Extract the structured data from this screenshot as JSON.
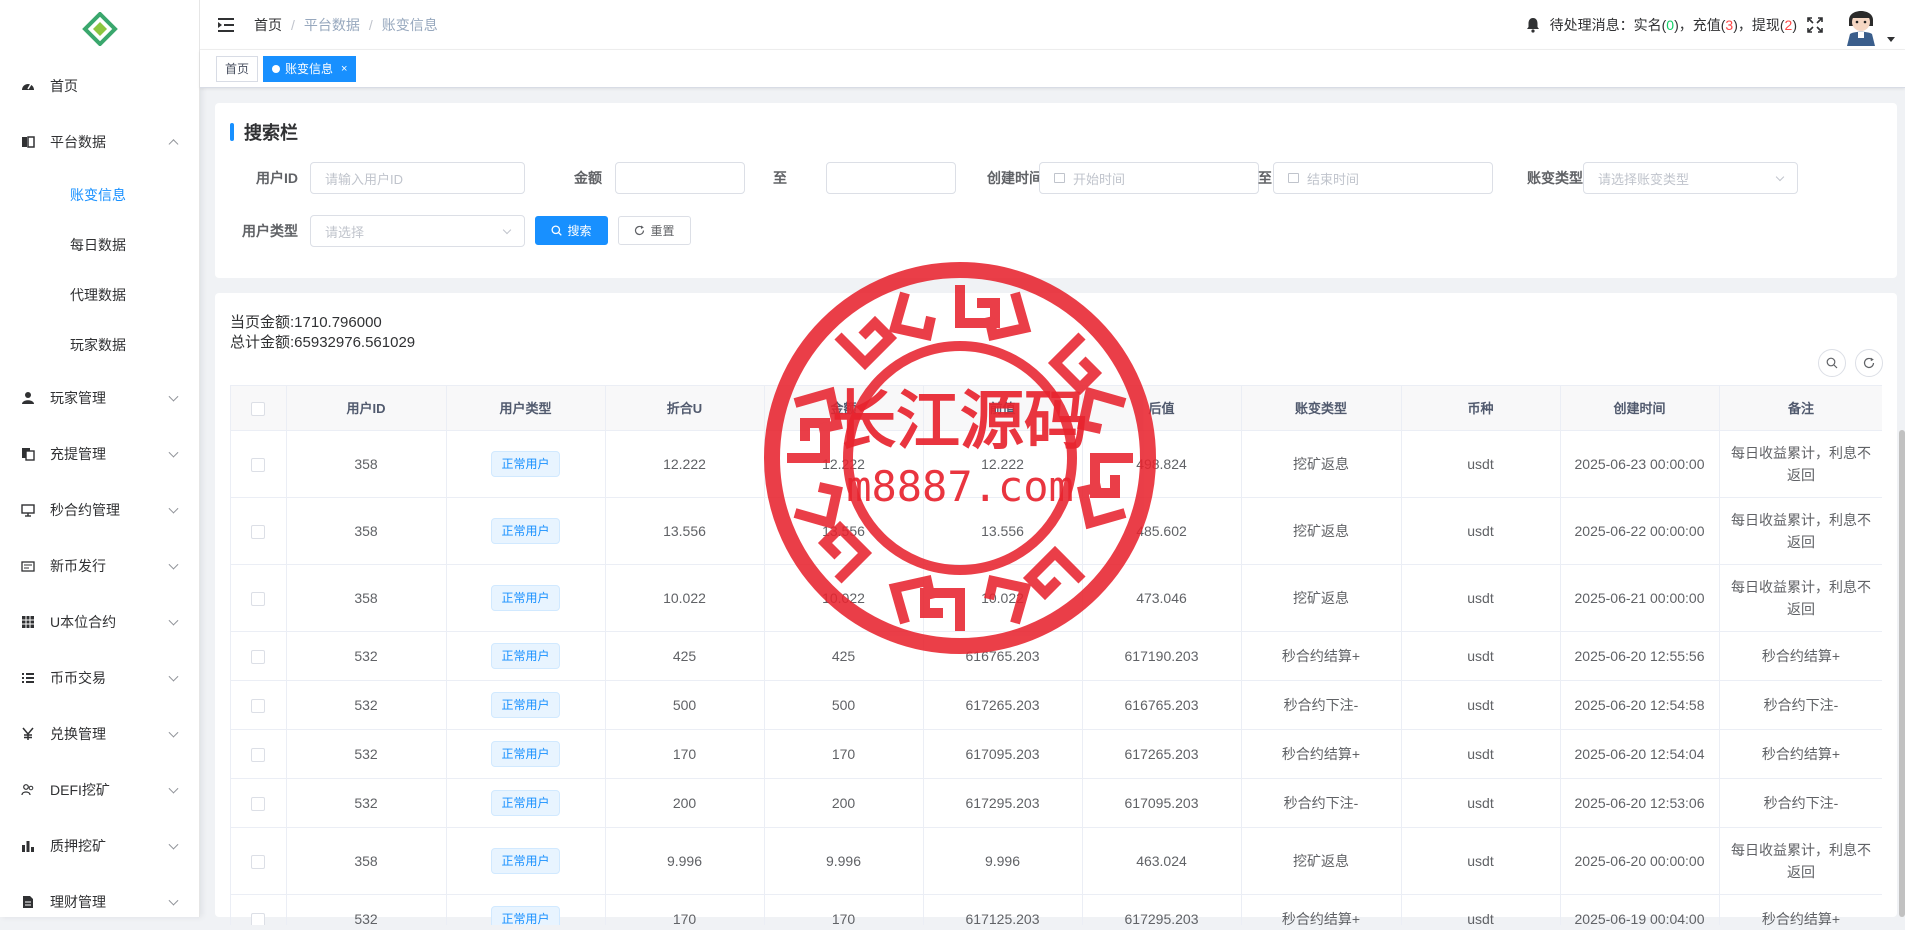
{
  "sidebar": {
    "items": [
      {
        "label": "首页",
        "icon": "dashboard-icon",
        "has_children": false
      },
      {
        "label": "平台数据",
        "icon": "book-icon",
        "has_children": true,
        "expanded": true,
        "children": [
          {
            "label": "账变信息",
            "active": true
          },
          {
            "label": "每日数据",
            "active": false
          },
          {
            "label": "代理数据",
            "active": false
          },
          {
            "label": "玩家数据",
            "active": false
          }
        ]
      },
      {
        "label": "玩家管理",
        "icon": "user-icon",
        "has_children": true
      },
      {
        "label": "充提管理",
        "icon": "copy-icon",
        "has_children": true
      },
      {
        "label": "秒合约管理",
        "icon": "monitor-icon",
        "has_children": true
      },
      {
        "label": "新币发行",
        "icon": "card-icon",
        "has_children": true
      },
      {
        "label": "U本位合约",
        "icon": "grid-icon",
        "has_children": true
      },
      {
        "label": "币币交易",
        "icon": "list-icon",
        "has_children": true
      },
      {
        "label": "兑换管理",
        "icon": "yen-icon",
        "has_children": true
      },
      {
        "label": "DEFI挖矿",
        "icon": "people-icon",
        "has_children": true
      },
      {
        "label": "质押挖矿",
        "icon": "bar-chart-icon",
        "has_children": true
      },
      {
        "label": "理财管理",
        "icon": "document-icon",
        "has_children": true
      }
    ]
  },
  "header": {
    "breadcrumb": [
      "首页",
      "平台数据",
      "账变信息"
    ],
    "pending_prefix": "待处理消息：实名(",
    "pending_realname": "0",
    "pending_mid1": ")，充值(",
    "pending_recharge": "3",
    "pending_mid2": ")，提现(",
    "pending_withdraw": "2",
    "pending_suffix": ")"
  },
  "tags": [
    {
      "label": "首页",
      "active": false
    },
    {
      "label": "账变信息",
      "active": true,
      "close": "×"
    }
  ],
  "search": {
    "title": "搜索栏",
    "user_id_label": "用户ID",
    "user_id_placeholder": "请输入用户ID",
    "amount_label": "金额",
    "to_label": "至",
    "created_label": "创建时间",
    "start_placeholder": "开始时间",
    "end_placeholder": "结束时间",
    "change_type_label": "账变类型",
    "change_type_placeholder": "请选择账变类型",
    "user_type_label": "用户类型",
    "user_type_placeholder": "请选择",
    "search_button": "搜索",
    "reset_button": "重置"
  },
  "summary": {
    "page_amount": "当页金额:1710.796000",
    "total_amount": "总计金额:65932976.561029"
  },
  "table": {
    "columns": [
      "用户ID",
      "用户类型",
      "折合U",
      "金额",
      "前值",
      "后值",
      "账变类型",
      "币种",
      "创建时间",
      "备注"
    ],
    "rows": [
      {
        "uid": "358",
        "type": "正常用户",
        "u": "12.222",
        "amount": "12.222",
        "before": "12.222",
        "after": "498.824",
        "change": "挖矿返息",
        "coin": "usdt",
        "time": "2025-06-23 00:00:00",
        "note": "每日收益累计，利息不返回"
      },
      {
        "uid": "358",
        "type": "正常用户",
        "u": "13.556",
        "amount": "13.556",
        "before": "13.556",
        "after": "485.602",
        "change": "挖矿返息",
        "coin": "usdt",
        "time": "2025-06-22 00:00:00",
        "note": "每日收益累计，利息不返回"
      },
      {
        "uid": "358",
        "type": "正常用户",
        "u": "10.022",
        "amount": "10.022",
        "before": "10.022",
        "after": "473.046",
        "change": "挖矿返息",
        "coin": "usdt",
        "time": "2025-06-21 00:00:00",
        "note": "每日收益累计，利息不返回"
      },
      {
        "uid": "532",
        "type": "正常用户",
        "u": "425",
        "amount": "425",
        "before": "616765.203",
        "after": "617190.203",
        "change": "秒合约结算+",
        "coin": "usdt",
        "time": "2025-06-20 12:55:56",
        "note": "秒合约结算+"
      },
      {
        "uid": "532",
        "type": "正常用户",
        "u": "500",
        "amount": "500",
        "before": "617265.203",
        "after": "616765.203",
        "change": "秒合约下注-",
        "coin": "usdt",
        "time": "2025-06-20 12:54:58",
        "note": "秒合约下注-"
      },
      {
        "uid": "532",
        "type": "正常用户",
        "u": "170",
        "amount": "170",
        "before": "617095.203",
        "after": "617265.203",
        "change": "秒合约结算+",
        "coin": "usdt",
        "time": "2025-06-20 12:54:04",
        "note": "秒合约结算+"
      },
      {
        "uid": "532",
        "type": "正常用户",
        "u": "200",
        "amount": "200",
        "before": "617295.203",
        "after": "617095.203",
        "change": "秒合约下注-",
        "coin": "usdt",
        "time": "2025-06-20 12:53:06",
        "note": "秒合约下注-"
      },
      {
        "uid": "358",
        "type": "正常用户",
        "u": "9.996",
        "amount": "9.996",
        "before": "9.996",
        "after": "463.024",
        "change": "挖矿返息",
        "coin": "usdt",
        "time": "2025-06-20 00:00:00",
        "note": "每日收益累计，利息不返回"
      },
      {
        "uid": "532",
        "type": "正常用户",
        "u": "170",
        "amount": "170",
        "before": "617125.203",
        "after": "617295.203",
        "change": "秒合约结算+",
        "coin": "usdt",
        "time": "2025-06-19 00:04:00",
        "note": "秒合约结算+"
      }
    ]
  },
  "watermark": {
    "title": "长江源码",
    "url": "m8887.com"
  },
  "colors": {
    "primary": "#1890ff",
    "stamp_red": "#e8242f",
    "success": "#13ce66",
    "danger": "#ff4949"
  }
}
